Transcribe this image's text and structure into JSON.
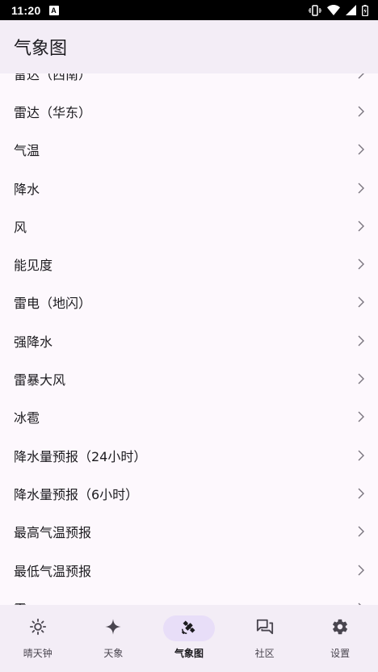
{
  "status_bar": {
    "time": "11:20",
    "notif_letter": "A"
  },
  "app_bar": {
    "title": "气象图"
  },
  "list": {
    "items": [
      {
        "label": "雷达（西南）"
      },
      {
        "label": "雷达（华东）"
      },
      {
        "label": "气温"
      },
      {
        "label": "降水"
      },
      {
        "label": "风"
      },
      {
        "label": "能见度"
      },
      {
        "label": "雷电（地闪）"
      },
      {
        "label": "强降水"
      },
      {
        "label": "雷暴大风"
      },
      {
        "label": "冰雹"
      },
      {
        "label": "降水量预报（24小时）"
      },
      {
        "label": "降水量预报（6小时）"
      },
      {
        "label": "最高气温预报"
      },
      {
        "label": "最低气温预报"
      },
      {
        "label": "雾"
      }
    ]
  },
  "bottom_nav": {
    "items": [
      {
        "label": "晴天钟",
        "icon": "sun-icon"
      },
      {
        "label": "天象",
        "icon": "sparkle-icon"
      },
      {
        "label": "气象图",
        "icon": "satellite-icon",
        "active": true
      },
      {
        "label": "社区",
        "icon": "forum-icon"
      },
      {
        "label": "设置",
        "icon": "gear-icon"
      }
    ]
  }
}
